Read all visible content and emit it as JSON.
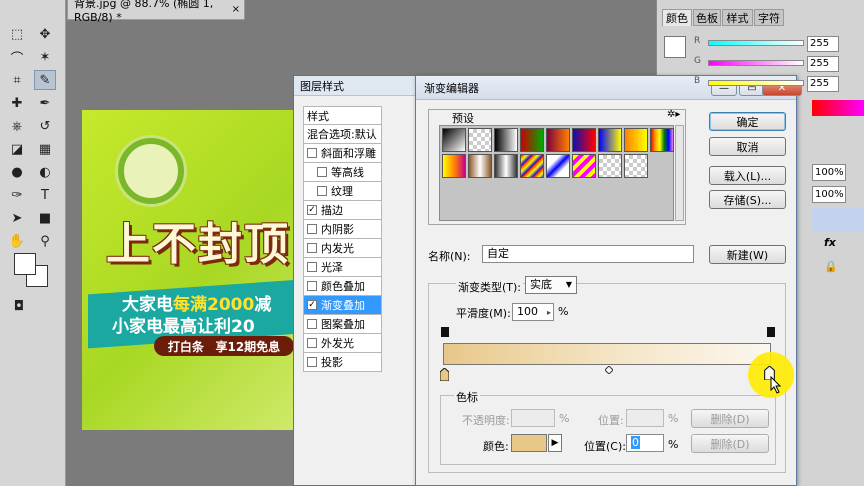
{
  "document_tab": {
    "title": "背景.jpg @ 88.7% (椭圆 1, RGB/8) *",
    "close": "×"
  },
  "canvas_art": {
    "headline": "上不封顶",
    "line1_a": "大家电",
    "line1_b": "每满2000",
    "line1_c": "减",
    "line2": "小家电最高让利20",
    "pill_left": "打白条",
    "pill_right": "享12期免息"
  },
  "tools_panel": {
    "tools": [
      "marquee-icon",
      "move-icon",
      "lasso-icon",
      "magic-wand-icon",
      "crop-icon",
      "eyedropper-icon",
      "healing-icon",
      "brush-icon",
      "stamp-icon",
      "history-brush-icon",
      "eraser-icon",
      "gradient-icon",
      "blur-icon",
      "dodge-icon",
      "pen-icon",
      "type-icon",
      "path-select-icon",
      "shape-icon",
      "hand-icon",
      "zoom-icon"
    ]
  },
  "right_panel": {
    "tabs": [
      "颜色",
      "色板",
      "样式",
      "字符"
    ],
    "channels": [
      {
        "label": "R",
        "value": "255"
      },
      {
        "label": "G",
        "value": "255"
      },
      {
        "label": "B",
        "value": "255"
      }
    ],
    "percent_values": [
      "100%",
      "100%"
    ],
    "fx": "fx"
  },
  "layer_style": {
    "title": "图层样式",
    "header": "样式",
    "blend": "混合选项:默认",
    "items": [
      {
        "label": "斜面和浮雕",
        "checked": false,
        "indent": false
      },
      {
        "label": "等高线",
        "checked": false,
        "indent": true
      },
      {
        "label": "纹理",
        "checked": false,
        "indent": true
      },
      {
        "label": "描边",
        "checked": true,
        "indent": false
      },
      {
        "label": "内阴影",
        "checked": false,
        "indent": false
      },
      {
        "label": "内发光",
        "checked": false,
        "indent": false
      },
      {
        "label": "光泽",
        "checked": false,
        "indent": false
      },
      {
        "label": "颜色叠加",
        "checked": false,
        "indent": false
      },
      {
        "label": "渐变叠加",
        "checked": true,
        "indent": false,
        "selected": true
      },
      {
        "label": "图案叠加",
        "checked": false,
        "indent": false
      },
      {
        "label": "外发光",
        "checked": false,
        "indent": false
      },
      {
        "label": "投影",
        "checked": false,
        "indent": false
      }
    ]
  },
  "gradient_editor": {
    "title": "渐变编辑器",
    "window_buttons": {
      "minimize": "—",
      "restore": "▭",
      "close": "✕"
    },
    "presets_label": "预设",
    "buttons": {
      "ok": "确定",
      "cancel": "取消",
      "load": "载入(L)...",
      "save": "存储(S)...",
      "new": "新建(W)"
    },
    "name_label": "名称(N):",
    "name_value": "自定",
    "type_label": "渐变类型(T):",
    "type_value": "实底",
    "smooth_label": "平滑度(M):",
    "smooth_value": "100",
    "smooth_unit": "%",
    "stops_label": "色标",
    "opacity_label": "不透明度:",
    "opacity_unit": "%",
    "location_label_disabled": "位置:",
    "delete_label": "删除(D)",
    "color_label": "颜色:",
    "location_label": "位置(C):",
    "location_value": "0",
    "location_unit": "%",
    "gradient_colors": {
      "start": "#e8c889",
      "end": "#fbf7ee"
    }
  }
}
